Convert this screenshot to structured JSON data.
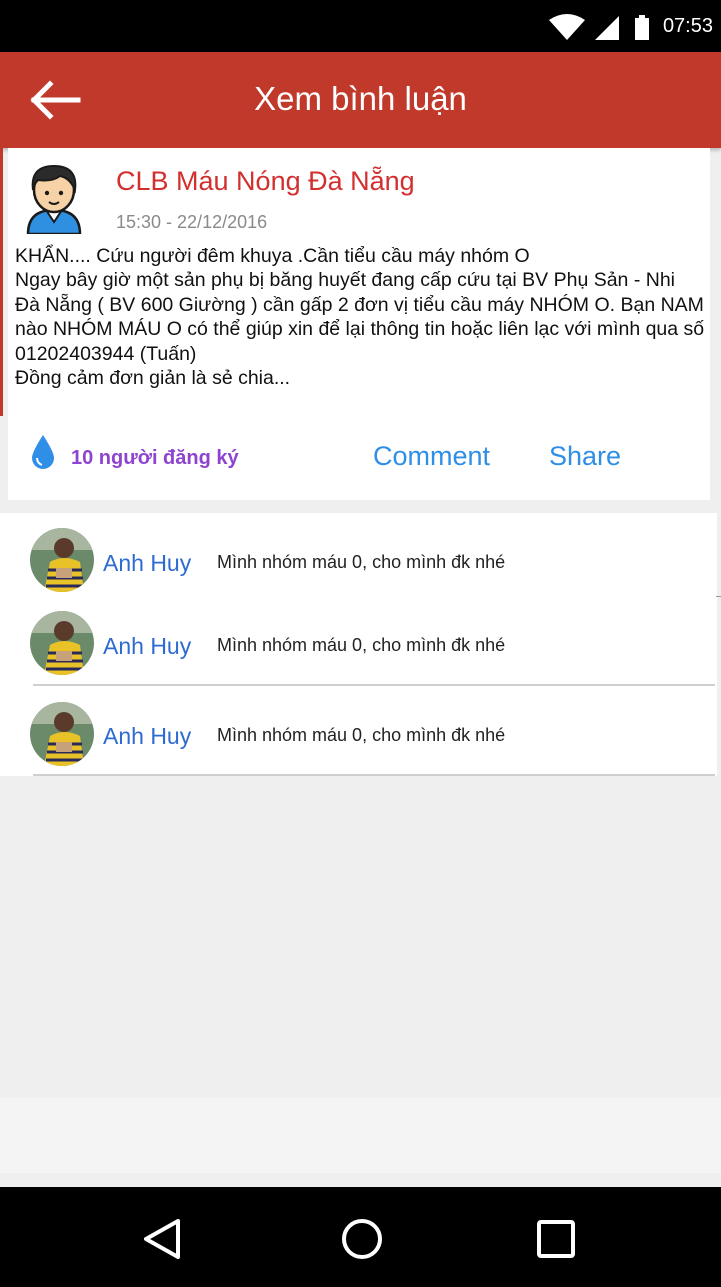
{
  "status_bar": {
    "time": "07:53",
    "icons": [
      "wifi-icon",
      "signal-icon",
      "battery-icon"
    ]
  },
  "app_bar": {
    "title": "Xem bình luận",
    "back_icon": "back-arrow-icon"
  },
  "post": {
    "author": "CLB Máu Nóng Đà Nẵng",
    "time": "15:30 - 22/12/2016",
    "body": "KHẨN.... Cứu người đêm khuya .Cần tiểu cầu máy nhóm O\nNgay bây giờ một sản phụ bị băng huyết đang cấp cứu tại BV Phụ Sản - Nhi Đà Nẵng ( BV 600 Giường ) cần gấp 2 đơn vị tiểu cầu máy NHÓM O. Bạn NAM nào NHÓM MÁU O có thể giúp xin để lại thông tin hoặc liên lạc với mình qua số 01202403944 (Tuấn)\nĐồng cảm đơn giản là sẻ chia...",
    "registered": "10 người đăng ký",
    "comment_label": "Comment",
    "share_label": "Share"
  },
  "comments": [
    {
      "name": "Anh Huy",
      "text": "Mình nhóm máu 0, cho mình đk nhé"
    },
    {
      "name": "Anh Huy",
      "text": "Mình nhóm máu 0, cho mình đk nhé"
    },
    {
      "name": "Anh Huy",
      "text": "Mình nhóm máu 0, cho mình đk nhé"
    }
  ],
  "colors": {
    "app_bar": "#c0392b",
    "author": "#d32f2f",
    "registered": "#8e44d0",
    "action": "#2f8ee5",
    "comment_name": "#2e6bd0"
  },
  "nav": {
    "icons": [
      "back-triangle-icon",
      "home-circle-icon",
      "recents-square-icon"
    ]
  }
}
